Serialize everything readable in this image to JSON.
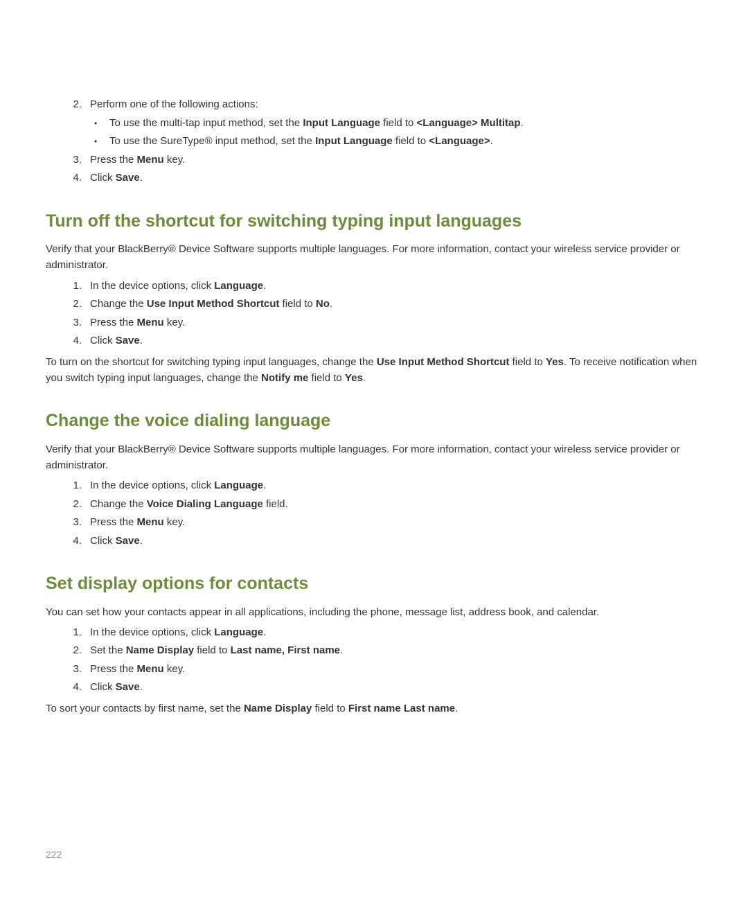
{
  "section0": {
    "step2_num": "2.",
    "step2_text": "Perform one of the following actions:",
    "bullet1_prefix": "To use the multi-tap input method, set the ",
    "bullet1_bold1": "Input Language",
    "bullet1_mid": " field to ",
    "bullet1_bold2": "<Language> Multitap",
    "bullet1_suffix": ".",
    "bullet2_prefix": "To use the SureType® input method, set the ",
    "bullet2_bold1": "Input Language",
    "bullet2_mid": " field to ",
    "bullet2_bold2": "<Language>",
    "bullet2_suffix": ".",
    "step3_num": "3.",
    "step3_prefix": "Press the ",
    "step3_bold": "Menu",
    "step3_suffix": " key.",
    "step4_num": "4.",
    "step4_prefix": "Click ",
    "step4_bold": "Save",
    "step4_suffix": "."
  },
  "section1": {
    "heading": "Turn off the shortcut for switching typing input languages",
    "intro": "Verify that your BlackBerry® Device Software supports multiple languages. For more information, contact your wireless service provider or administrator.",
    "step1_num": "1.",
    "step1_prefix": "In the device options, click ",
    "step1_bold": "Language",
    "step1_suffix": ".",
    "step2_num": "2.",
    "step2_prefix": "Change the ",
    "step2_bold1": "Use Input Method Shortcut",
    "step2_mid": " field to ",
    "step2_bold2": "No",
    "step2_suffix": ".",
    "step3_num": "3.",
    "step3_prefix": "Press the ",
    "step3_bold": "Menu",
    "step3_suffix": " key.",
    "step4_num": "4.",
    "step4_prefix": "Click ",
    "step4_bold": "Save",
    "step4_suffix": ".",
    "outro_prefix": "To turn on the shortcut for switching typing input languages, change the ",
    "outro_bold1": "Use Input Method Shortcut",
    "outro_mid1": " field to ",
    "outro_bold2": "Yes",
    "outro_mid2": ". To receive notification when you switch typing input languages, change the ",
    "outro_bold3": "Notify me",
    "outro_mid3": " field to ",
    "outro_bold4": "Yes",
    "outro_suffix": "."
  },
  "section2": {
    "heading": "Change the voice dialing language",
    "intro": "Verify that your BlackBerry® Device Software supports multiple languages. For more information, contact your wireless service provider or administrator.",
    "step1_num": "1.",
    "step1_prefix": "In the device options, click ",
    "step1_bold": "Language",
    "step1_suffix": ".",
    "step2_num": "2.",
    "step2_prefix": "Change the ",
    "step2_bold": "Voice Dialing Language",
    "step2_suffix": " field.",
    "step3_num": "3.",
    "step3_prefix": "Press the ",
    "step3_bold": "Menu",
    "step3_suffix": " key.",
    "step4_num": "4.",
    "step4_prefix": "Click ",
    "step4_bold": "Save",
    "step4_suffix": "."
  },
  "section3": {
    "heading": "Set display options for contacts",
    "intro": "You can set how your contacts appear in all applications, including the phone, message list, address book, and calendar.",
    "step1_num": "1.",
    "step1_prefix": "In the device options, click ",
    "step1_bold": "Language",
    "step1_suffix": ".",
    "step2_num": "2.",
    "step2_prefix": "Set the ",
    "step2_bold1": "Name Display",
    "step2_mid": " field to ",
    "step2_bold2": "Last name, First name",
    "step2_suffix": ".",
    "step3_num": "3.",
    "step3_prefix": "Press the ",
    "step3_bold": "Menu",
    "step3_suffix": " key.",
    "step4_num": "4.",
    "step4_prefix": "Click ",
    "step4_bold": "Save",
    "step4_suffix": ".",
    "outro_prefix": "To sort your contacts by first name, set the ",
    "outro_bold1": "Name Display",
    "outro_mid": " field to ",
    "outro_bold2": "First name Last name",
    "outro_suffix": "."
  },
  "pageNumber": "222"
}
